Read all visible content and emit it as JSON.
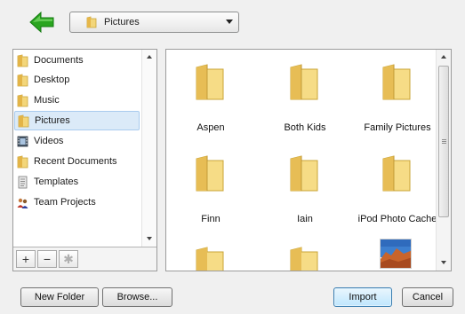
{
  "toolbar": {
    "back_icon": "green-back-arrow-icon",
    "location": {
      "label": "Pictures",
      "icon": "folder-icon"
    }
  },
  "sidebar": {
    "items": [
      {
        "label": "Documents",
        "icon": "folder-icon",
        "selected": false
      },
      {
        "label": "Desktop",
        "icon": "folder-icon",
        "selected": false
      },
      {
        "label": "Music",
        "icon": "folder-icon",
        "selected": false
      },
      {
        "label": "Pictures",
        "icon": "folder-icon",
        "selected": true
      },
      {
        "label": "Videos",
        "icon": "film-icon",
        "selected": false
      },
      {
        "label": "Recent Documents",
        "icon": "folder-icon",
        "selected": false
      },
      {
        "label": "Templates",
        "icon": "document-icon",
        "selected": false
      },
      {
        "label": "Team Projects",
        "icon": "people-icon",
        "selected": false
      }
    ],
    "buttons": [
      {
        "label": "+",
        "icon": "plus-icon"
      },
      {
        "label": "−",
        "icon": "minus-icon"
      },
      {
        "label": "✱",
        "icon": "gear-icon",
        "disabled": true
      }
    ]
  },
  "files": [
    {
      "name": "Aspen",
      "type": "folder"
    },
    {
      "name": "Both Kids",
      "type": "folder"
    },
    {
      "name": "Family Pictures",
      "type": "folder"
    },
    {
      "name": "Finn",
      "type": "folder"
    },
    {
      "name": "Iain",
      "type": "folder"
    },
    {
      "name": "iPod Photo Cache",
      "type": "folder"
    },
    {
      "name": "",
      "type": "folder"
    },
    {
      "name": "",
      "type": "folder"
    },
    {
      "name": "",
      "type": "image"
    }
  ],
  "footer": {
    "new_folder": "New Folder",
    "browse": "Browse...",
    "import": "Import",
    "cancel": "Cancel"
  },
  "colors": {
    "folder": "#f3d67a",
    "selection": "#dbeaf8",
    "back_arrow": "#2aa51f"
  }
}
